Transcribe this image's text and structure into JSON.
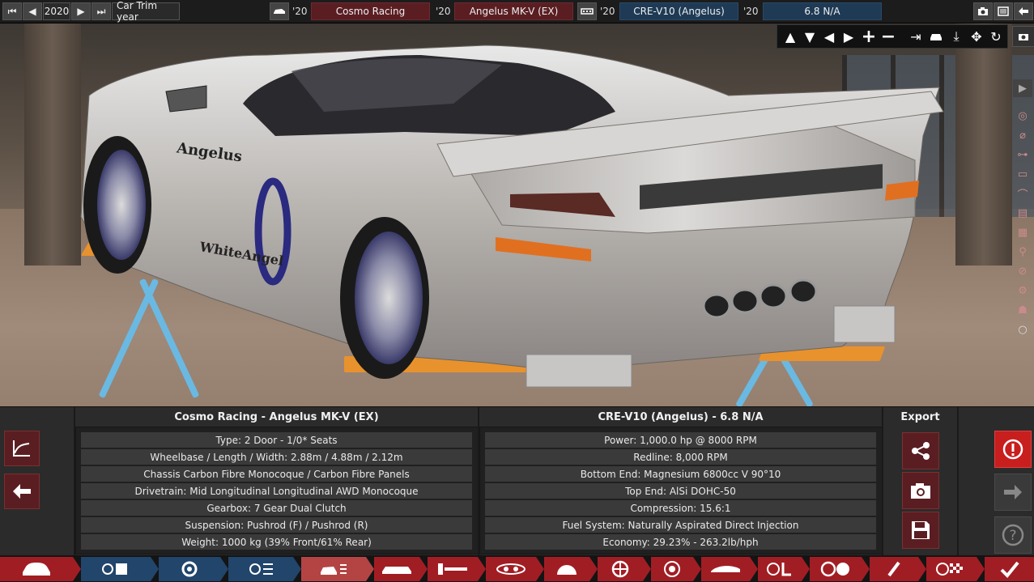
{
  "topbar": {
    "year": "2020",
    "car_trim_year_label": "Car Trim year",
    "model_year": "'20",
    "family_name": "Cosmo Racing",
    "trim_year": "'20",
    "trim_name": "Angelus MK-V (EX)",
    "engine_year": "'20",
    "engine_family": "CRE-V10 (Angelus)",
    "variant_year": "'20",
    "variant_name": "6.8 N/A"
  },
  "car_panel": {
    "title": "Cosmo Racing - Angelus MK-V (EX)",
    "rows": [
      "Type: 2 Door - 1/0* Seats",
      "Wheelbase / Length / Width: 2.88m / 4.88m / 2.12m",
      "Chassis Carbon Fibre Monocoque / Carbon Fibre Panels",
      "Drivetrain: Mid Longitudinal Longitudinal AWD Monocoque",
      "Gearbox: 7 Gear Dual Clutch",
      "Suspension: Pushrod (F) / Pushrod (R)",
      "Weight: 1000 kg (39% Front/61% Rear)"
    ]
  },
  "engine_panel": {
    "title": "CRE-V10 (Angelus) - 6.8 N/A",
    "rows": [
      "Power: 1,000.0 hp @ 8000 RPM",
      "Redline:  8,000 RPM",
      "Bottom End: Magnesium 6800cc V 90°10",
      "Top End: AlSi DOHC-50",
      "Compression: 15.6:1",
      "Fuel System: Naturally Aspirated Direct Injection",
      "Economy: 29.23% - 263.2lb/hph"
    ]
  },
  "export": {
    "title": "Export"
  },
  "livery": {
    "brand": "Angelus",
    "sponsor": "WhiteAngel"
  },
  "colors": {
    "accent_red": "#a11d24",
    "accent_blue": "#21456b",
    "alert": "#c81e1e",
    "lift": "#e8922e"
  }
}
